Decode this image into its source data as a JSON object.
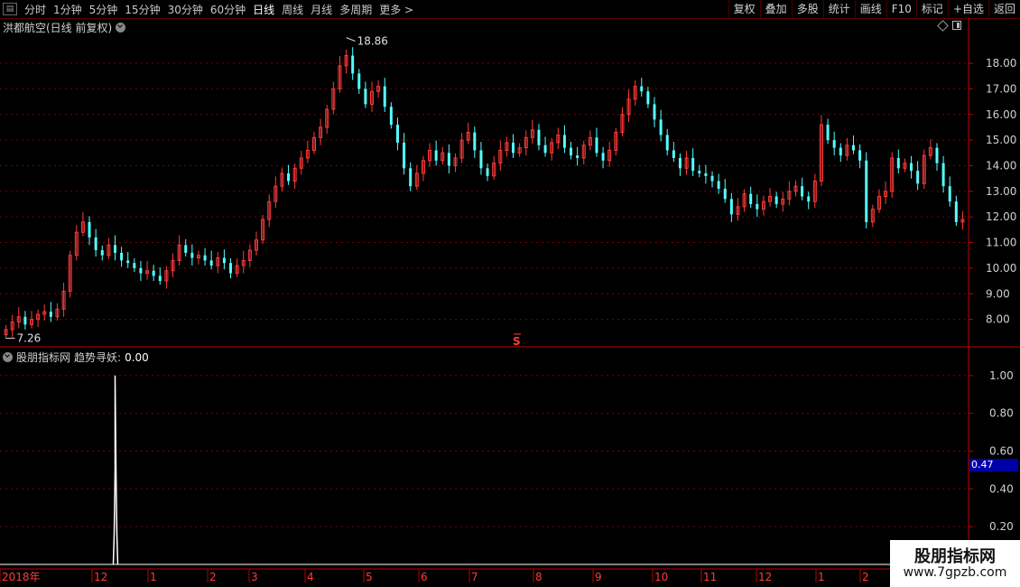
{
  "toolbar": {
    "left_items": [
      "分时",
      "1分钟",
      "5分钟",
      "15分钟",
      "30分钟",
      "60分钟",
      "日线",
      "周线",
      "月线",
      "多周期",
      "更多 >"
    ],
    "active": "日线",
    "right_items": [
      "复权",
      "叠加",
      "多股",
      "统计",
      "画线",
      "F10",
      "标记",
      "+自选",
      "返回"
    ]
  },
  "main": {
    "title": "洪都航空(日线 前复权)",
    "high_label": "18.86",
    "low_label": "7.26",
    "marker": "S",
    "price_ticks": [
      "18.00",
      "17.00",
      "16.00",
      "15.00",
      "14.00",
      "13.00",
      "12.00",
      "11.00",
      "10.00",
      "9.00",
      "8.00"
    ]
  },
  "indicator": {
    "name": "股朋指标网",
    "series_label": "趋势寻妖:",
    "series_value": "0.00",
    "ticks": [
      "1.00",
      "0.80",
      "0.60",
      "0.40",
      "0.20"
    ],
    "current_tag": "0.47"
  },
  "time_axis": [
    "2018年",
    "12",
    "1",
    "2",
    "3",
    "4",
    "5",
    "6",
    "7",
    "8",
    "9",
    "10",
    "11",
    "12",
    "1",
    "2"
  ],
  "watermark": {
    "line1": "股朋指标网",
    "line2": "www.7gpzb.com"
  },
  "colors": {
    "up": "#ff3b3b",
    "down": "#54ffff",
    "grid": "#800000",
    "axis": "#c00000",
    "tag_bg": "#0000a8"
  },
  "chart_data": {
    "type": "candlestick",
    "title": "洪都航空(日线 前复权)",
    "price_range": [
      7.0,
      19.2
    ],
    "indicator_range": [
      0,
      1.1
    ],
    "closes": [
      7.6,
      7.9,
      8.1,
      7.8,
      8.0,
      8.2,
      8.3,
      8.1,
      8.4,
      9.1,
      10.5,
      11.4,
      11.8,
      11.2,
      10.7,
      10.5,
      10.9,
      10.6,
      10.3,
      10.2,
      10.0,
      9.8,
      9.9,
      9.7,
      9.5,
      9.9,
      10.3,
      10.9,
      10.6,
      10.4,
      10.5,
      10.3,
      10.1,
      10.4,
      10.2,
      9.8,
      10.1,
      10.3,
      10.7,
      11.1,
      11.9,
      12.6,
      13.2,
      13.7,
      13.4,
      13.9,
      14.3,
      14.6,
      15.1,
      15.5,
      16.2,
      17.0,
      17.9,
      18.3,
      17.6,
      17.0,
      16.4,
      16.9,
      17.1,
      16.3,
      15.6,
      14.9,
      13.9,
      13.2,
      13.7,
      14.2,
      14.6,
      14.2,
      14.5,
      14.0,
      14.3,
      15.0,
      15.3,
      14.6,
      13.9,
      13.6,
      14.1,
      14.6,
      14.9,
      14.5,
      14.7,
      15.1,
      15.4,
      14.8,
      14.5,
      14.9,
      15.2,
      14.7,
      14.4,
      14.3,
      14.8,
      15.1,
      14.5,
      14.2,
      14.6,
      15.3,
      16.0,
      16.6,
      17.1,
      16.9,
      16.4,
      15.8,
      15.2,
      14.6,
      14.3,
      13.9,
      14.3,
      13.8,
      13.7,
      13.6,
      13.4,
      13.1,
      12.7,
      12.1,
      12.4,
      12.9,
      12.5,
      12.3,
      12.6,
      12.8,
      12.5,
      12.7,
      13.0,
      13.2,
      12.8,
      12.6,
      13.4,
      15.6,
      15.0,
      14.7,
      14.4,
      14.8,
      14.6,
      14.2,
      11.8,
      12.3,
      12.8,
      13.0,
      14.3,
      13.9,
      14.1,
      13.8,
      13.3,
      14.4,
      14.7,
      14.1,
      13.2,
      12.6,
      11.8,
      11.9
    ],
    "indicator_spike": {
      "bar_index": 17,
      "value": 1.0
    }
  }
}
